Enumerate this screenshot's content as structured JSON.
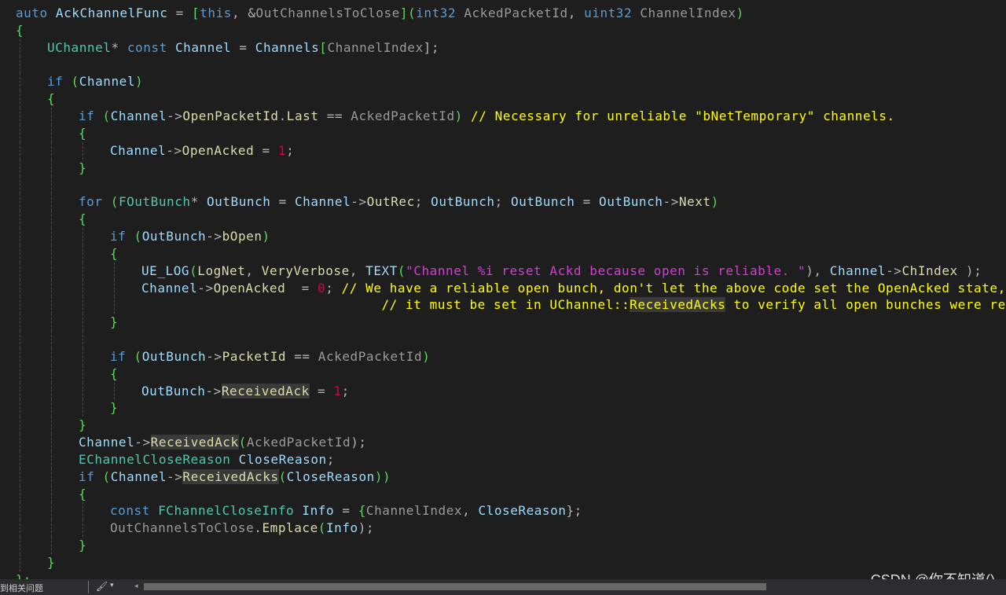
{
  "colors": {
    "background": "#1e1e1e",
    "keyword": "#569cd6",
    "type": "#4ec9b0",
    "variable": "#9cdcfe",
    "member": "#dcdcaa",
    "operator": "#b4b4b4",
    "brace": "#5fd75f",
    "number": "#d7004a",
    "string": "#d040d0",
    "comment": "#ffff00",
    "parameter": "#9a9a9a",
    "plain": "#dcdcdc"
  },
  "code_lines": [
    {
      "indent": 0,
      "tokens": [
        [
          "auto",
          "k"
        ],
        [
          " ",
          "p"
        ],
        [
          "AckChannelFunc",
          "v"
        ],
        [
          " = ",
          "o"
        ],
        [
          "[",
          "b"
        ],
        [
          "this",
          "k"
        ],
        [
          ", ",
          "o"
        ],
        [
          "&",
          "o"
        ],
        [
          "OutChannelsToClose",
          "g"
        ],
        [
          "](",
          "b"
        ],
        [
          "int32",
          "k"
        ],
        [
          " ",
          "p"
        ],
        [
          "AckedPacketId",
          "g"
        ],
        [
          ", ",
          "o"
        ],
        [
          "uint32",
          "k"
        ],
        [
          " ",
          "p"
        ],
        [
          "ChannelIndex",
          "g"
        ],
        [
          ")",
          "b"
        ]
      ]
    },
    {
      "indent": 0,
      "tokens": [
        [
          "{",
          "b"
        ]
      ]
    },
    {
      "indent": 1,
      "tokens": [
        [
          "UChannel",
          "t"
        ],
        [
          "* ",
          "o"
        ],
        [
          "const",
          "k"
        ],
        [
          " ",
          "p"
        ],
        [
          "Channel",
          "v"
        ],
        [
          " = ",
          "o"
        ],
        [
          "Channels",
          "v"
        ],
        [
          "[",
          "b"
        ],
        [
          "ChannelIndex",
          "g"
        ],
        [
          "];",
          "o"
        ]
      ]
    },
    {
      "indent": 1,
      "tokens": []
    },
    {
      "indent": 1,
      "tokens": [
        [
          "if",
          "k"
        ],
        [
          " (",
          "b"
        ],
        [
          "Channel",
          "v"
        ],
        [
          ")",
          "b"
        ]
      ]
    },
    {
      "indent": 1,
      "tokens": [
        [
          "{",
          "b"
        ]
      ]
    },
    {
      "indent": 2,
      "tokens": [
        [
          "if",
          "k"
        ],
        [
          " (",
          "b"
        ],
        [
          "Channel",
          "v"
        ],
        [
          "->",
          "o"
        ],
        [
          "OpenPacketId",
          "m"
        ],
        [
          ".",
          "o"
        ],
        [
          "Last",
          "m"
        ],
        [
          " == ",
          "o"
        ],
        [
          "AckedPacketId",
          "g"
        ],
        [
          ")",
          "b"
        ],
        [
          " // Necessary for unreliable \"bNetTemporary\" channels.",
          "c"
        ]
      ]
    },
    {
      "indent": 2,
      "tokens": [
        [
          "{",
          "b"
        ]
      ]
    },
    {
      "indent": 3,
      "tokens": [
        [
          "Channel",
          "v"
        ],
        [
          "->",
          "o"
        ],
        [
          "OpenAcked",
          "m"
        ],
        [
          " = ",
          "o"
        ],
        [
          "1",
          "n"
        ],
        [
          ";",
          "o"
        ]
      ]
    },
    {
      "indent": 2,
      "tokens": [
        [
          "}",
          "b"
        ]
      ]
    },
    {
      "indent": 2,
      "tokens": []
    },
    {
      "indent": 2,
      "tokens": [
        [
          "for",
          "k"
        ],
        [
          " (",
          "b"
        ],
        [
          "FOutBunch",
          "t"
        ],
        [
          "* ",
          "o"
        ],
        [
          "OutBunch",
          "v"
        ],
        [
          " = ",
          "o"
        ],
        [
          "Channel",
          "v"
        ],
        [
          "->",
          "o"
        ],
        [
          "OutRec",
          "m"
        ],
        [
          "; ",
          "o"
        ],
        [
          "OutBunch",
          "v"
        ],
        [
          "; ",
          "o"
        ],
        [
          "OutBunch",
          "v"
        ],
        [
          " = ",
          "o"
        ],
        [
          "OutBunch",
          "v"
        ],
        [
          "->",
          "o"
        ],
        [
          "Next",
          "m"
        ],
        [
          ")",
          "b"
        ]
      ]
    },
    {
      "indent": 2,
      "tokens": [
        [
          "{",
          "b"
        ]
      ]
    },
    {
      "indent": 3,
      "tokens": [
        [
          "if",
          "k"
        ],
        [
          " (",
          "b"
        ],
        [
          "OutBunch",
          "v"
        ],
        [
          "->",
          "o"
        ],
        [
          "bOpen",
          "m"
        ],
        [
          ")",
          "b"
        ]
      ]
    },
    {
      "indent": 3,
      "tokens": [
        [
          "{",
          "b"
        ]
      ]
    },
    {
      "indent": 4,
      "tokens": [
        [
          "UE_LOG",
          "v"
        ],
        [
          "(",
          "b"
        ],
        [
          "LogNet",
          "m"
        ],
        [
          ", ",
          "o"
        ],
        [
          "VeryVerbose",
          "m"
        ],
        [
          ", ",
          "o"
        ],
        [
          "TEXT",
          "v"
        ],
        [
          "(",
          "b"
        ],
        [
          "\"Channel %i reset Ackd because open is reliable. \"",
          "s"
        ],
        [
          "), ",
          "o"
        ],
        [
          "Channel",
          "v"
        ],
        [
          "->",
          "o"
        ],
        [
          "ChIndex",
          "m"
        ],
        [
          " );",
          "o"
        ]
      ]
    },
    {
      "indent": 4,
      "tokens": [
        [
          "Channel",
          "v"
        ],
        [
          "->",
          "o"
        ],
        [
          "OpenAcked",
          "m"
        ],
        [
          "  = ",
          "o"
        ],
        [
          "0",
          "n"
        ],
        [
          "; ",
          "o"
        ],
        [
          "// We have a reliable open bunch, don't let the above code set the OpenAcked state,",
          "c"
        ]
      ]
    },
    {
      "indent": 4,
      "tokens": [
        [
          "                              ",
          "p"
        ],
        [
          "// it must be set in UChannel::",
          "c"
        ],
        [
          "ReceivedAcks",
          "ch"
        ],
        [
          " to verify all open bunches were received.",
          "c"
        ]
      ]
    },
    {
      "indent": 3,
      "tokens": [
        [
          "}",
          "b"
        ]
      ]
    },
    {
      "indent": 3,
      "tokens": []
    },
    {
      "indent": 3,
      "tokens": [
        [
          "if",
          "k"
        ],
        [
          " (",
          "b"
        ],
        [
          "OutBunch",
          "v"
        ],
        [
          "->",
          "o"
        ],
        [
          "PacketId",
          "m"
        ],
        [
          " == ",
          "o"
        ],
        [
          "AckedPacketId",
          "g"
        ],
        [
          ")",
          "b"
        ]
      ]
    },
    {
      "indent": 3,
      "tokens": [
        [
          "{",
          "b"
        ]
      ]
    },
    {
      "indent": 4,
      "tokens": [
        [
          "OutBunch",
          "v"
        ],
        [
          "->",
          "o"
        ],
        [
          "ReceivedAck",
          "mh"
        ],
        [
          " = ",
          "o"
        ],
        [
          "1",
          "n"
        ],
        [
          ";",
          "o"
        ]
      ]
    },
    {
      "indent": 3,
      "tokens": [
        [
          "}",
          "b"
        ]
      ]
    },
    {
      "indent": 2,
      "tokens": [
        [
          "}",
          "b"
        ]
      ]
    },
    {
      "indent": 2,
      "tokens": [
        [
          "Channel",
          "v"
        ],
        [
          "->",
          "o"
        ],
        [
          "ReceivedAck",
          "mh"
        ],
        [
          "(",
          "b"
        ],
        [
          "AckedPacketId",
          "g"
        ],
        [
          ");",
          "o"
        ]
      ]
    },
    {
      "indent": 2,
      "tokens": [
        [
          "EChannelCloseReason",
          "t"
        ],
        [
          " ",
          "p"
        ],
        [
          "CloseReason",
          "v"
        ],
        [
          ";",
          "o"
        ]
      ]
    },
    {
      "indent": 2,
      "tokens": [
        [
          "if",
          "k"
        ],
        [
          " (",
          "b"
        ],
        [
          "Channel",
          "v"
        ],
        [
          "->",
          "o"
        ],
        [
          "ReceivedAcks",
          "mh"
        ],
        [
          "(",
          "b"
        ],
        [
          "CloseReason",
          "v"
        ],
        [
          "))",
          "b"
        ]
      ]
    },
    {
      "indent": 2,
      "tokens": [
        [
          "{",
          "b"
        ]
      ]
    },
    {
      "indent": 3,
      "tokens": [
        [
          "const",
          "k"
        ],
        [
          " ",
          "p"
        ],
        [
          "FChannelCloseInfo",
          "t"
        ],
        [
          " ",
          "p"
        ],
        [
          "Info",
          "v"
        ],
        [
          " = ",
          "o"
        ],
        [
          "{",
          "b"
        ],
        [
          "ChannelIndex",
          "g"
        ],
        [
          ", ",
          "o"
        ],
        [
          "CloseReason",
          "v"
        ],
        [
          "};",
          "o"
        ]
      ]
    },
    {
      "indent": 3,
      "tokens": [
        [
          "OutChannelsToClose",
          "g"
        ],
        [
          ".",
          "o"
        ],
        [
          "Emplace",
          "m"
        ],
        [
          "(",
          "b"
        ],
        [
          "Info",
          "v"
        ],
        [
          ");",
          "o"
        ]
      ]
    },
    {
      "indent": 2,
      "tokens": [
        [
          "}",
          "b"
        ]
      ]
    },
    {
      "indent": 1,
      "tokens": [
        [
          "}",
          "b"
        ]
      ]
    }
  ],
  "statusbar": {
    "text": "到相关问题",
    "brush_icon": "brush-icon",
    "caret": "▾",
    "scroll_left": "◂"
  },
  "watermark": "CSDN @你不知道()"
}
